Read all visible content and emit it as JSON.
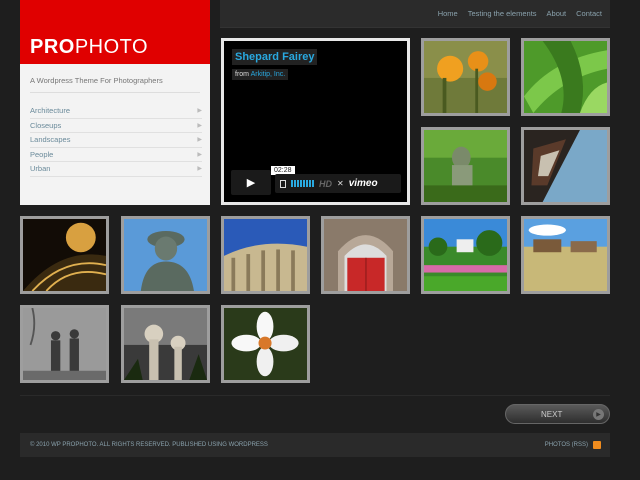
{
  "nav": [
    "Home",
    "Testing the elements",
    "About",
    "Contact"
  ],
  "sidebar": {
    "logo_bold": "PRO",
    "logo_rest": "PHOTO",
    "tagline": "A Wordpress Theme For Photographers",
    "menu": [
      "Architecture",
      "Closeups",
      "Landscapes",
      "People",
      "Urban"
    ]
  },
  "video": {
    "title": "Shepard Fairey",
    "from_label": "from",
    "author": "Arkitip, Inc.",
    "time": "02:28",
    "brand": "vimeo",
    "hd": "HD"
  },
  "thumbnails": [
    {
      "subject": "orange flowers"
    },
    {
      "subject": "green succulent"
    },
    {
      "subject": "statue in garden"
    },
    {
      "subject": "window architecture"
    },
    {
      "subject": "glowing dome"
    },
    {
      "subject": "soldier statue"
    },
    {
      "subject": "curved building"
    },
    {
      "subject": "red door archway"
    },
    {
      "subject": "garden landscape"
    },
    {
      "subject": "field with building"
    },
    {
      "subject": "sculptures"
    },
    {
      "subject": "domed towers"
    },
    {
      "subject": "white flower"
    }
  ],
  "pagination": {
    "next_label": "NEXT"
  },
  "footer": {
    "copyright": "© 2010 WP PROPHOTO. ALL RIGHTS RESERVED. PUBLISHED USING WORDPRESS",
    "rss": "PHOTOS (RSS)"
  }
}
